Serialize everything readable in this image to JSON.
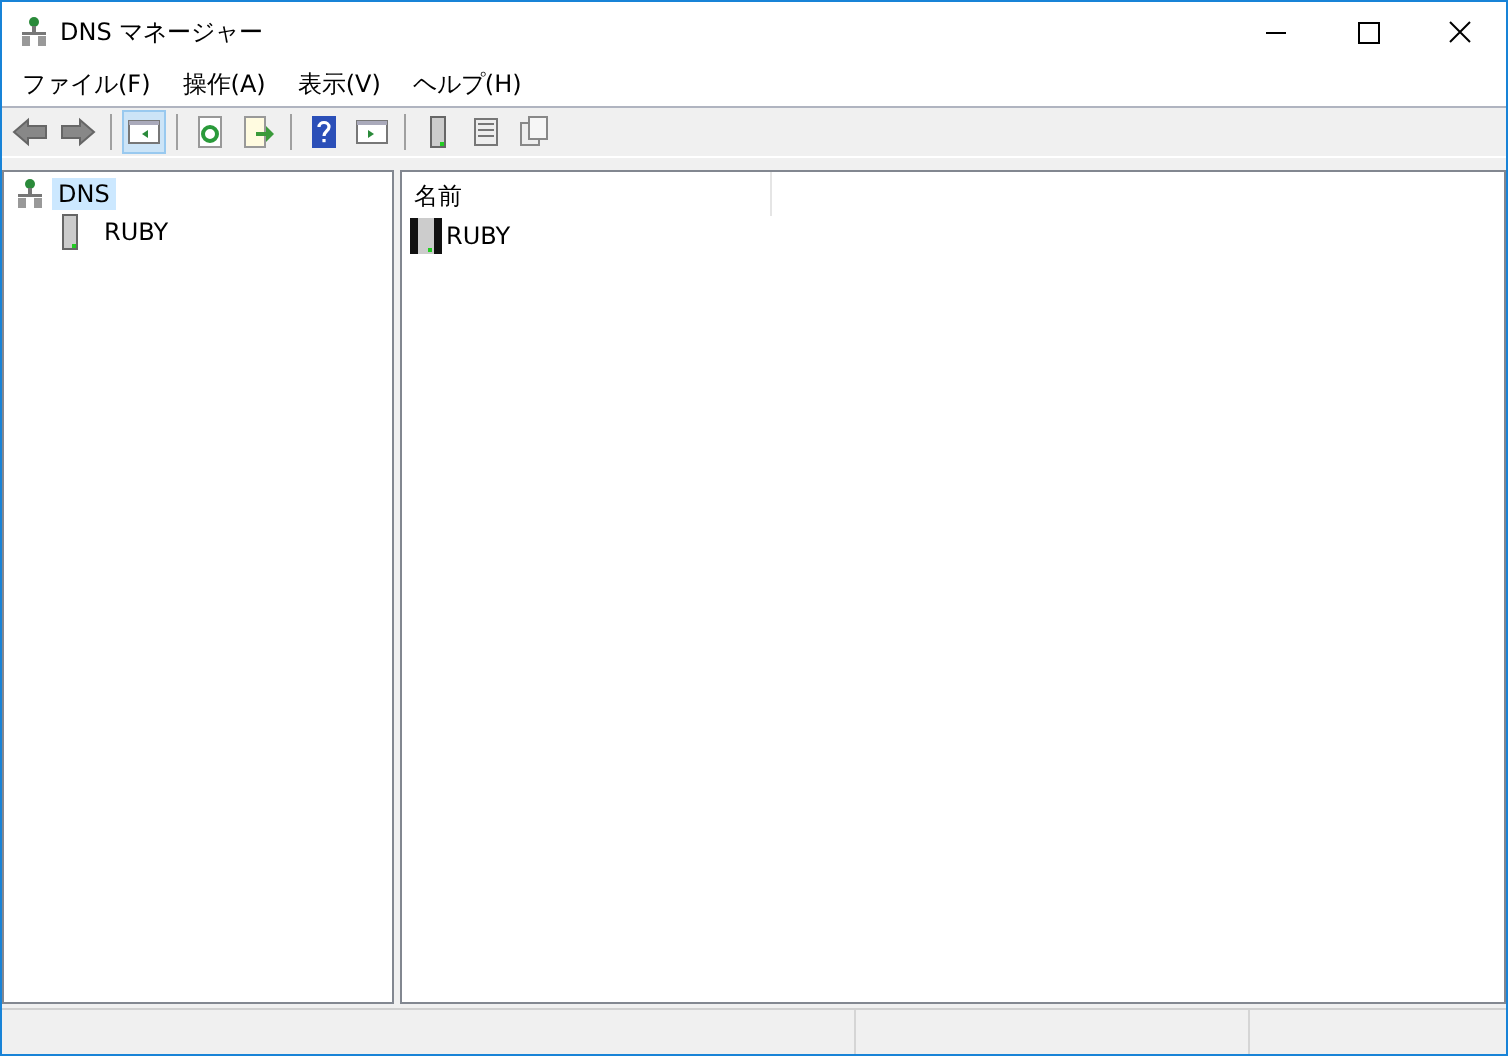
{
  "window": {
    "title": "DNS マネージャー"
  },
  "menu": [
    "ファイル(F)",
    "操作(A)",
    "表示(V)",
    "ヘルプ(H)"
  ],
  "toolbar": [
    [
      {
        "kind": "back",
        "selected": false
      },
      {
        "kind": "forward",
        "selected": false
      }
    ],
    [
      {
        "kind": "tree",
        "selected": true
      }
    ],
    [
      {
        "kind": "refresh",
        "selected": false
      },
      {
        "kind": "export",
        "selected": false
      }
    ],
    [
      {
        "kind": "help",
        "selected": false
      },
      {
        "kind": "pane",
        "selected": false
      }
    ],
    [
      {
        "kind": "server",
        "selected": false
      },
      {
        "kind": "list",
        "selected": false
      },
      {
        "kind": "copy",
        "selected": false
      }
    ]
  ],
  "tree": [
    {
      "label": "DNS",
      "selected": true,
      "children": [
        {
          "label": "RUBY",
          "selected": false
        }
      ]
    }
  ],
  "list": {
    "columns": [
      "名前"
    ],
    "rows": [
      {
        "name": "RUBY"
      }
    ]
  }
}
